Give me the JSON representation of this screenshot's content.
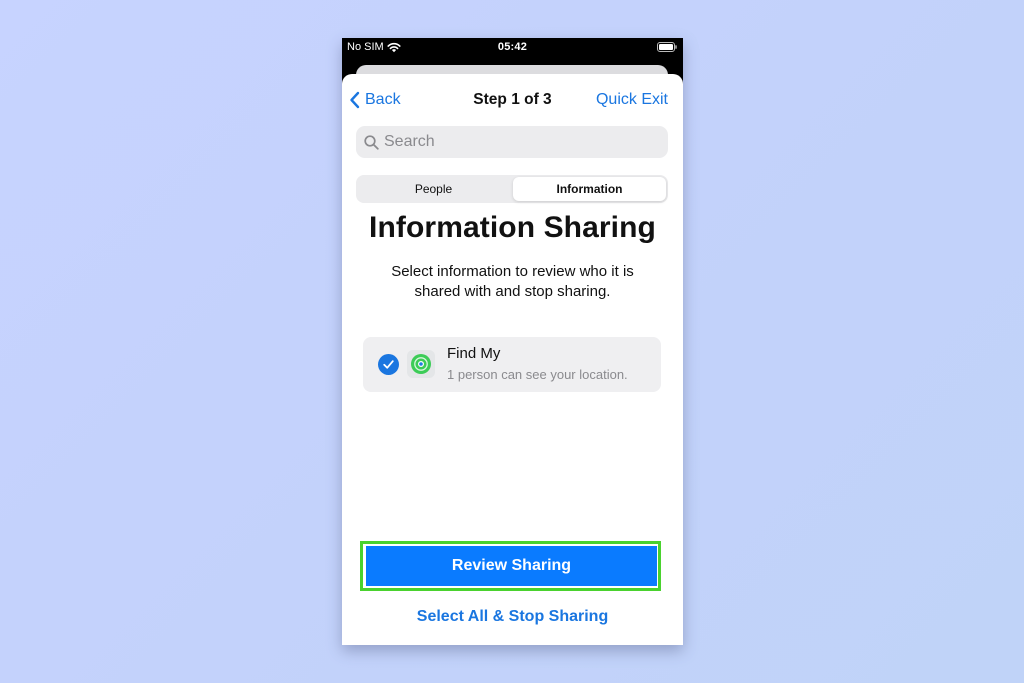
{
  "status_bar": {
    "carrier": "No SIM",
    "time": "05:42"
  },
  "nav": {
    "back_label": "Back",
    "title": "Step 1 of 3",
    "quick_exit_label": "Quick Exit"
  },
  "search": {
    "placeholder": "Search",
    "value": ""
  },
  "segmented_control": {
    "segments": [
      "People",
      "Information"
    ],
    "selected": "Information"
  },
  "main": {
    "title": "Information Sharing",
    "description": "Select information to review who it is shared with and stop sharing."
  },
  "apps": [
    {
      "name": "Find My",
      "detail": "1 person can see your location.",
      "checked": true,
      "icon": "find-my-icon"
    }
  ],
  "actions": {
    "review_label": "Review Sharing",
    "select_all_label": "Select All & Stop Sharing"
  },
  "colors": {
    "accent": "#0a7bff",
    "link": "#1a76e0",
    "highlight": "#4ad22e",
    "background": "#c5d3fc"
  }
}
